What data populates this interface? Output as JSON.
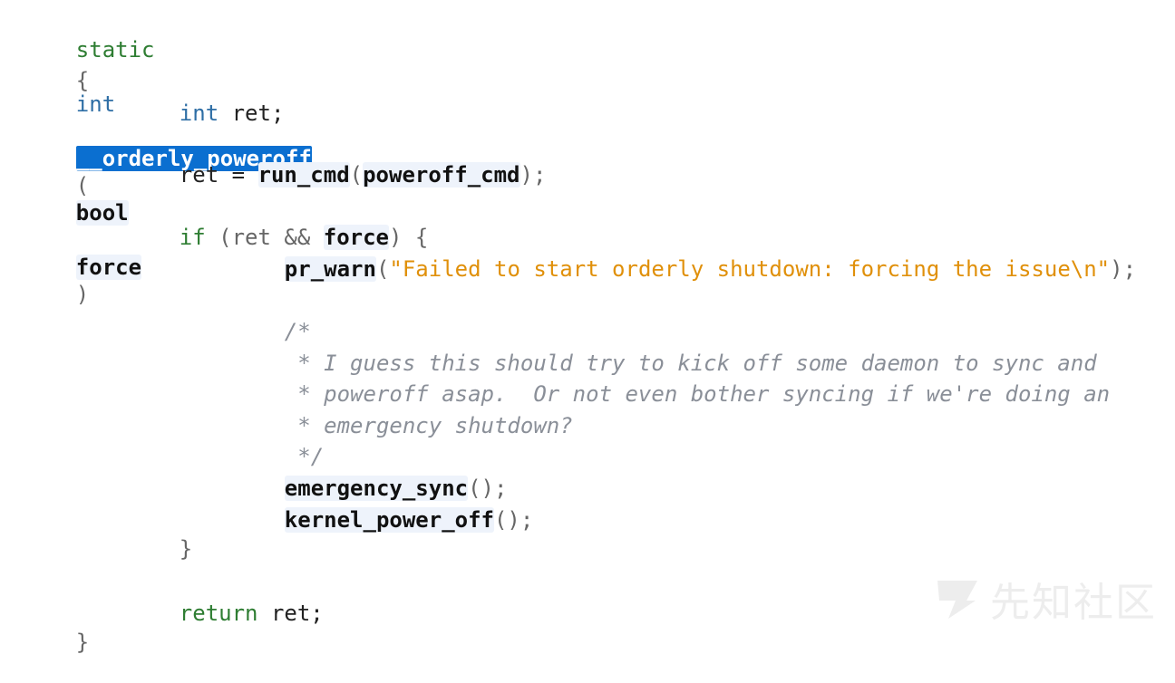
{
  "code": {
    "l1": {
      "t_static": "static",
      "t_int": "int",
      "t_func": "__orderly_poweroff",
      "t_lparen": "(",
      "t_bool": "bool",
      "t_force": "force",
      "t_rparen": ")"
    },
    "l2": {
      "t_brace": "{"
    },
    "l3": {
      "t_int": "int",
      "t_rest": " ret;"
    },
    "l4": {
      "t_ret": "ret = ",
      "t_runcmd": "run_cmd",
      "t_lparen": "(",
      "t_arg": "poweroff_cmd",
      "t_end": ");"
    },
    "l5": {
      "t_if": "if",
      "t_mid": " (ret && ",
      "t_force": "force",
      "t_end": ") {"
    },
    "l6": {
      "t_func": "pr_warn",
      "t_lparen": "(",
      "t_str": "\"Failed to start orderly shutdown: forcing the issue\\n\"",
      "t_end": ");"
    },
    "comment": {
      "c1": "/*",
      "c2": " * I guess this should try to kick off some daemon to sync and",
      "c3": " * poweroff asap.  Or not even bother syncing if we're doing an",
      "c4": " * emergency shutdown?",
      "c5": " */"
    },
    "l7": {
      "t_func": "emergency_sync",
      "t_end": "();"
    },
    "l8": {
      "t_func": "kernel_power_off",
      "t_end": "();"
    },
    "l9": {
      "t_brace": "}"
    },
    "l10": {
      "t_return": "return",
      "t_rest": " ret;"
    },
    "l11": {
      "t_brace": "}"
    }
  },
  "watermark": {
    "text": "先知社区",
    "icon": "xianzhi-logo-icon"
  },
  "colors": {
    "selection": "#0b6fd0",
    "string": "#e0900a",
    "comment": "#8a8f98",
    "keyword": "#2e7d32",
    "type": "#2e6ea5"
  }
}
